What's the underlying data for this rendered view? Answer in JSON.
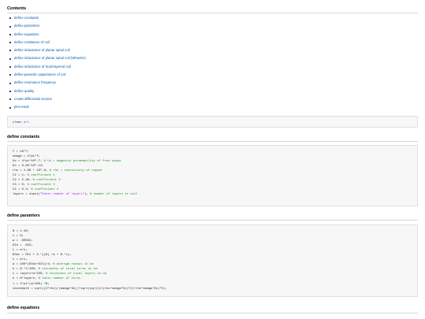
{
  "contents_heading": "Contents",
  "toc": [
    "define constants",
    "define paramters",
    "define equations",
    "define resistance of coil",
    "define inductance of planar spiral coil",
    "define inductance of planar spiral coil (Wheeler)",
    "define inductance of multi-layered coil",
    "define parasitic capacitance of coil",
    "define resonance frequency",
    "define quality",
    "create differential vectors",
    "plot result"
  ],
  "clear_block": {
    "code": "clear",
    "arg": " all"
  },
  "sections": {
    "constants": {
      "title": "define constants",
      "lines": [
        {
          "code": "f = 10^7;",
          "comment": ""
        },
        {
          "code": "omega = 2*pi*f;",
          "comment": ""
        },
        {
          "code": "Uo = 4*pi*10^-7; ",
          "comment": "% Uo = magnetic permeability of free space"
        },
        {
          "code": "Eo = 8.85*10^-12;",
          "comment": ""
        },
        {
          "code": "rho = 1.68 * 10^-8; ",
          "comment": "% rho = resistivity of copper"
        },
        {
          "code": "C1 = 1; ",
          "comment": "% coefficient 1"
        },
        {
          "code": "C2 = 2.46; ",
          "comment": "% coefficient 2"
        },
        {
          "code": "C3 = 0; ",
          "comment": "% coefficient 3"
        },
        {
          "code": "C4 = 0.2; ",
          "comment": "% coefficient 4"
        },
        {
          "code": "layers = input(",
          "str": "\"Enter number of layers\"",
          "tail": "); ",
          "comment": "% number of layers in coil"
        }
      ]
    },
    "paramters": {
      "title": "define paramters",
      "lines": [
        {
          "code": "N = 1:40;",
          "comment": ""
        },
        {
          "code": "s = 0;",
          "comment": ""
        },
        {
          "code": "w = .00032;",
          "comment": ""
        },
        {
          "code": "DIn = .015;",
          "comment": ""
        },
        {
          "code": "t = w*s;",
          "comment": ""
        },
        {
          "code": "DOut = DIn + 2.*((N).*w + N.*s);",
          "comment": ""
        },
        {
          "code": "t = w*s;",
          "comment": ""
        },
        {
          "code": "a = 100*(DOut+DIn)/4; ",
          "comment": "% Average radius in cm"
        },
        {
          "code": "b = N.*t*100; ",
          "comment": "% thickness of total turns in cm"
        },
        {
          "code": "c = layers*w*100; ",
          "comment": "% thickness of total layers in cm"
        },
        {
          "code": "n = N*layers; ",
          "comment": "% total number of turns"
        },
        {
          "code": "l = 2*pi*(a/100).*N;",
          "comment": ""
        },
        {
          "code": "skindepth = sqrt((2*rho)/(omega*Uo))*sqrt(sqrt(1+(rho*omega*Eo)^2)+rho*omega*Eo)^2);",
          "comment": ""
        }
      ]
    },
    "equations": {
      "title": "define equations"
    }
  }
}
